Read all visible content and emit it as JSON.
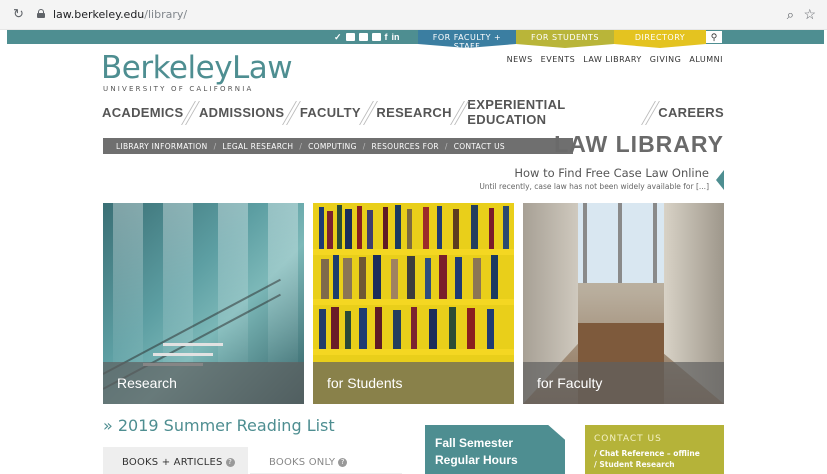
{
  "browser": {
    "url_domain": "law.berkeley.edu",
    "url_path": "/library/"
  },
  "topbar": {
    "social_icons": [
      "twitter-icon",
      "youtube-icon",
      "instagram-icon",
      "flickr-icon",
      "facebook-icon",
      "linkedin-icon"
    ],
    "tabs": [
      "FOR FACULTY + STAFF",
      "FOR STUDENTS",
      "DIRECTORY"
    ]
  },
  "logo": {
    "name": "BerkeleyLaw",
    "sub": "UNIVERSITY OF CALIFORNIA"
  },
  "secondary_nav": [
    "NEWS",
    "EVENTS",
    "LAW LIBRARY",
    "GIVING",
    "ALUMNI"
  ],
  "main_nav": [
    "ACADEMICS",
    "ADMISSIONS",
    "FACULTY",
    "RESEARCH",
    "EXPERIENTIAL EDUCATION",
    "CAREERS"
  ],
  "library_nav": [
    "LIBRARY INFORMATION",
    "LEGAL RESEARCH",
    "COMPUTING",
    "RESOURCES FOR",
    "CONTACT US"
  ],
  "section_title": "LAW LIBRARY",
  "feature": {
    "title": "How to Find Free Case Law Online",
    "excerpt": "Until recently, case law has not been widely available for [...]"
  },
  "tiles": [
    "Research",
    "for Students",
    "for Faculty"
  ],
  "summer_link": "» 2019 Summer Reading List",
  "search_tabs": {
    "books": "BOOKS + ARTICLES",
    "only": "BOOKS ONLY"
  },
  "fall": {
    "line1": "Fall Semester",
    "line2": "Regular Hours"
  },
  "contact": {
    "heading": "CONTACT US",
    "item1": "/ Chat Reference – offline",
    "item2": "/ Student Research"
  },
  "colors": {
    "teal": "#4e8e91",
    "blue": "#3b7ea1",
    "olive": "#b9b539",
    "gold": "#e4c320",
    "gray_bar": "#6f6f6f"
  }
}
